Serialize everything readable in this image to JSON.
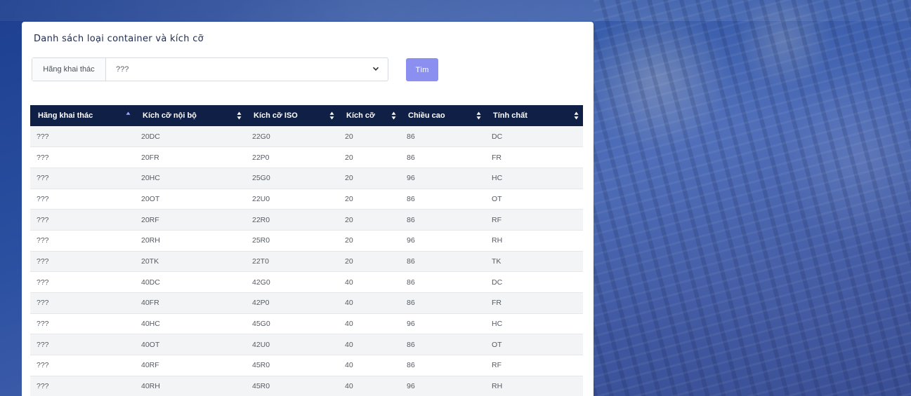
{
  "panel": {
    "title": "Danh sách loại container và kích cỡ"
  },
  "filter": {
    "label": "Hãng khai thác",
    "selected": "???"
  },
  "search_button": {
    "label": "Tìm"
  },
  "colors": {
    "header_bg": "#0f1f45",
    "button_bg": "#8a8ff0",
    "background": "#2a4fa0"
  },
  "table": {
    "columns": [
      {
        "label": "Hãng khai thác",
        "sort": "asc"
      },
      {
        "label": "Kích cỡ nội bộ",
        "sort": "both"
      },
      {
        "label": "Kích cỡ ISO",
        "sort": "both"
      },
      {
        "label": "Kích cỡ",
        "sort": "both"
      },
      {
        "label": "Chiều cao",
        "sort": "both"
      },
      {
        "label": "Tính chất",
        "sort": "both"
      }
    ],
    "rows": [
      [
        "???",
        "20DC",
        "22G0",
        "20",
        "86",
        "DC"
      ],
      [
        "???",
        "20FR",
        "22P0",
        "20",
        "86",
        "FR"
      ],
      [
        "???",
        "20HC",
        "25G0",
        "20",
        "96",
        "HC"
      ],
      [
        "???",
        "20OT",
        "22U0",
        "20",
        "86",
        "OT"
      ],
      [
        "???",
        "20RF",
        "22R0",
        "20",
        "86",
        "RF"
      ],
      [
        "???",
        "20RH",
        "25R0",
        "20",
        "96",
        "RH"
      ],
      [
        "???",
        "20TK",
        "22T0",
        "20",
        "86",
        "TK"
      ],
      [
        "???",
        "40DC",
        "42G0",
        "40",
        "86",
        "DC"
      ],
      [
        "???",
        "40FR",
        "42P0",
        "40",
        "86",
        "FR"
      ],
      [
        "???",
        "40HC",
        "45G0",
        "40",
        "96",
        "HC"
      ],
      [
        "???",
        "40OT",
        "42U0",
        "40",
        "86",
        "OT"
      ],
      [
        "???",
        "40RF",
        "45R0",
        "40",
        "86",
        "RF"
      ],
      [
        "???",
        "40RH",
        "45R0",
        "40",
        "96",
        "RH"
      ]
    ]
  }
}
